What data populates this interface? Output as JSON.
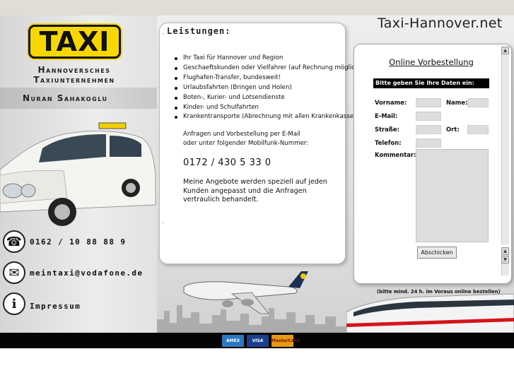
{
  "header": {
    "site_title": "Taxi-Hannover.net"
  },
  "left": {
    "logo_text": "TAXI",
    "company_line1": "Hannoversches",
    "company_line2": "Taxiunternehmen",
    "owner": "Nuran Sahakoglu",
    "phone": "0162 / 10 88 88 9",
    "email": "meintaxi@vodafone.de",
    "impressum": "Impressum"
  },
  "services": {
    "title": "Leistungen:",
    "items": [
      "Ihr Taxi für Hannover und Region",
      "Geschaeftskunden oder Vielfahrer (auf Rechnung möglich)",
      "Flughafen-Transfer, bundesweit!",
      "Urlaubsfahrten (Bringen und Holen)",
      "Boten-, Kurier- und Lotsendienste",
      "Kinder- und Schulfahrten",
      "Krankentransporte (Abrechnung mit allen Krankenkassen)"
    ],
    "inquiry_line1": "Anfragen und Vorbestellung per E-Mail",
    "inquiry_line2": "oder unter folgender Mobilfunk-Nummer:",
    "mobile": "0172 / 430 5 33 0",
    "offer_text": "Meine Angebote werden speziell auf jeden Kunden angepasst und die Anfragen vertraulich behandelt."
  },
  "form": {
    "title": "Online Vorbestellung",
    "header": "Bitte geben Sie Ihre Daten ein:",
    "labels": {
      "vorname": "Vorname:",
      "name": "Name:",
      "email": "E-Mail:",
      "strasse": "Straße:",
      "ort": "Ort:",
      "telefon": "Telefon:",
      "kommentar": "Kommentar:"
    },
    "submit": "Abschicken",
    "note": "(bitte mind. 24 h. im Voraus online bestellen)"
  },
  "payment": {
    "amex": "AMEX",
    "visa": "VISA",
    "mastercard": "MasterCard"
  },
  "colors": {
    "taxi_yellow": "#f7d700",
    "top_bar": "#e0ddd6",
    "bottom_bar": "#050505"
  }
}
